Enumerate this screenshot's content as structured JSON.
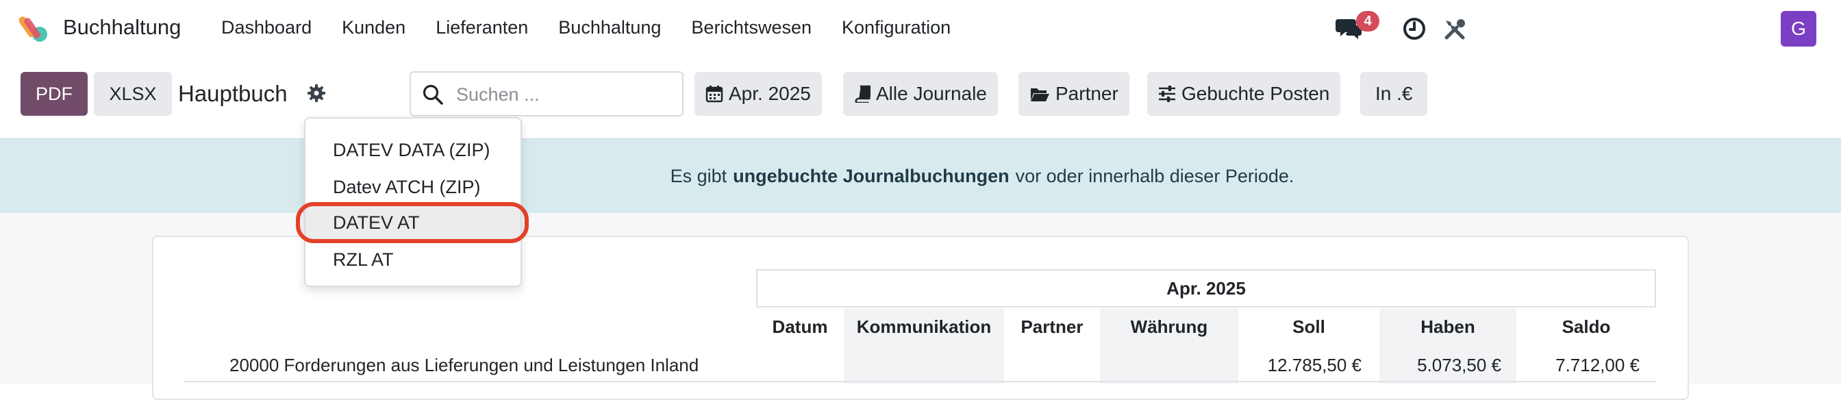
{
  "app": {
    "name": "Buchhaltung",
    "colors": {
      "primary": "#714b67",
      "accent_ring": "#e2412a",
      "badge": "#d44c59",
      "avatar": "#7b3fc4",
      "alert_bg": "#d7ebef"
    }
  },
  "navbar": {
    "menu": [
      "Dashboard",
      "Kunden",
      "Lieferanten",
      "Buchhaltung",
      "Berichtswesen",
      "Konfiguration"
    ],
    "messages_badge": "4",
    "avatar_initial": "G",
    "icons": [
      "chat-icon",
      "clock-icon",
      "tools-icon"
    ]
  },
  "toolbar": {
    "pdf_label": "PDF",
    "xlsx_label": "XLSX",
    "report_title": "Hauptbuch",
    "search_placeholder": "Suchen ...",
    "filters": {
      "period": "Apr. 2025",
      "journals": "Alle Journale",
      "partner": "Partner",
      "entries": "Gebuchte Posten",
      "currency": "In .€"
    }
  },
  "export_menu": {
    "items": [
      "DATEV DATA (ZIP)",
      "Datev ATCH (ZIP)",
      "DATEV AT",
      "RZL AT"
    ],
    "highlighted": "DATEV AT"
  },
  "alert": {
    "pre": "Es gibt",
    "bold": "ungebuchte Journalbuchungen",
    "post": "vor oder innerhalb dieser Periode."
  },
  "report": {
    "period_header": "Apr. 2025",
    "columns": [
      "Datum",
      "Kommunikation",
      "Partner",
      "Währung",
      "Soll",
      "Haben",
      "Saldo"
    ],
    "rows": [
      {
        "account": "20000 Forderungen aus Lieferungen und Leistungen Inland",
        "soll": "12.785,50 €",
        "haben": "5.073,50 €",
        "saldo": "7.712,00 €"
      }
    ]
  }
}
